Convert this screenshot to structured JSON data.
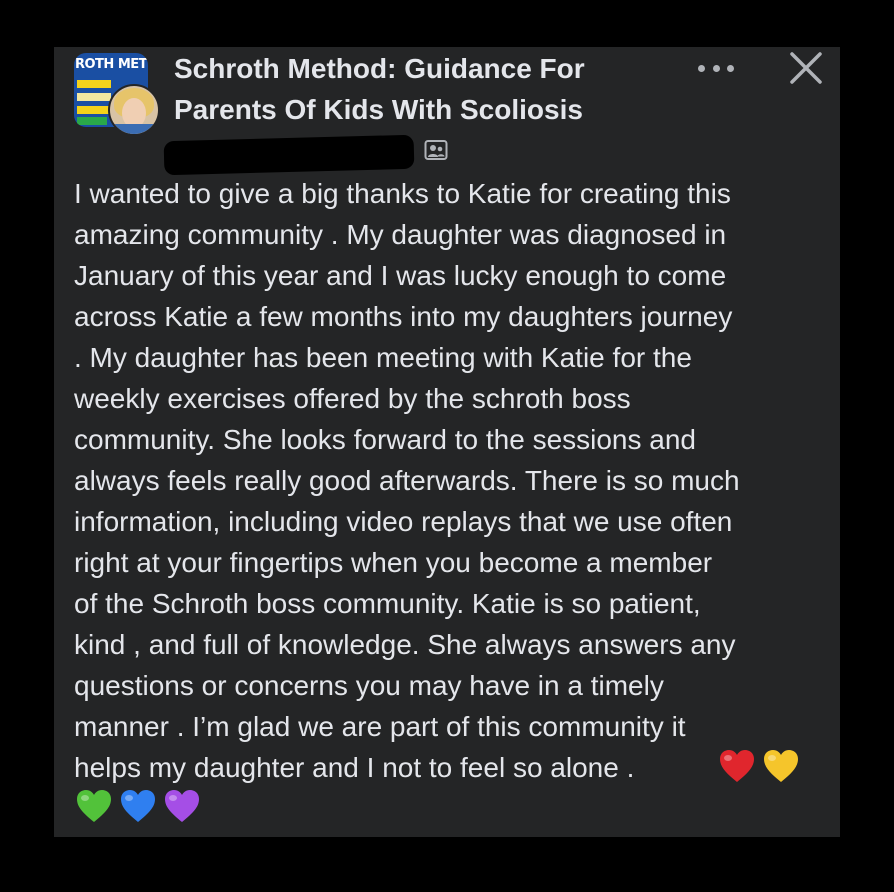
{
  "post": {
    "group_name": "Schroth Method: Guidance For Parents Of Kids With Scoliosis",
    "group_avatar_text": "ROTH MET",
    "author_redacted": true,
    "body": "I wanted to give a big thanks to Katie for creating this\namazing community . My daughter was diagnosed in\nJanuary of this year and I was lucky enough to come\nacross Katie a few months into my daughters journey\n. My daughter has been meeting with Katie for the\nweekly exercises offered by the schroth boss\ncommunity. She looks forward to the sessions and\nalways feels really good afterwards. There is so much\ninformation, including video replays that we use often\nright at your fingertips when you become a member\nof the Schroth boss community. Katie is so patient,\nkind , and full of knowledge. She always answers any\nquestions or concerns you may have in a timely\nmanner . I’m glad we are part of this community it\nhelps my daughter and I not to feel so alone .",
    "emojis": [
      {
        "name": "red-heart",
        "color": "#e0262d"
      },
      {
        "name": "yellow-heart",
        "color": "#f5c52b"
      },
      {
        "name": "green-heart",
        "color": "#52c23a"
      },
      {
        "name": "blue-heart",
        "color": "#2f7ff0"
      },
      {
        "name": "purple-heart",
        "color": "#a54ee6"
      }
    ]
  },
  "icons": {
    "more": "more-options-icon",
    "close": "close-icon",
    "member": "group-member-icon"
  },
  "colors": {
    "card_background": "#242526",
    "text": "#e4e6eb",
    "secondary": "#b0b3b8"
  }
}
